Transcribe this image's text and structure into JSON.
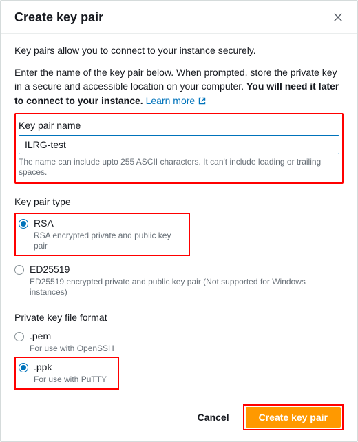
{
  "header": {
    "title": "Create key pair"
  },
  "body": {
    "intro": "Key pairs allow you to connect to your instance securely.",
    "desc_plain": "Enter the name of the key pair below. When prompted, store the private key in a secure and accessible location on your computer. ",
    "desc_bold": "You will need it later to connect to your instance.",
    "learn_more": "Learn more"
  },
  "form": {
    "name_label": "Key pair name",
    "name_value": "ILRG-test",
    "name_helper": "The name can include upto 255 ASCII characters. It can't include leading or trailing spaces.",
    "type_label": "Key pair type",
    "type_options": [
      {
        "label": "RSA",
        "desc": "RSA encrypted private and public key pair",
        "checked": true
      },
      {
        "label": "ED25519",
        "desc": "ED25519 encrypted private and public key pair (Not supported for Windows instances)",
        "checked": false
      }
    ],
    "format_label": "Private key file format",
    "format_options": [
      {
        "label": ".pem",
        "desc": "For use with OpenSSH",
        "checked": false
      },
      {
        "label": ".ppk",
        "desc": "For use with PuTTY",
        "checked": true
      }
    ]
  },
  "footer": {
    "cancel": "Cancel",
    "create": "Create key pair"
  },
  "colors": {
    "primary": "#ff9900",
    "link": "#0073bb",
    "highlight": "#ff0000"
  }
}
